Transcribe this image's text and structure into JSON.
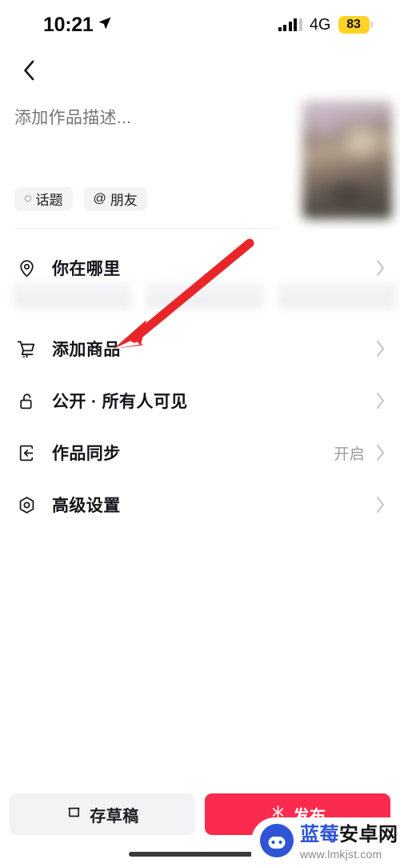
{
  "status_bar": {
    "time": "10:21",
    "location_icon": "location-arrow-icon",
    "network": "4G",
    "battery": "83",
    "battery_color": "#ffd426"
  },
  "nav": {
    "back_icon": "chevron-left-icon"
  },
  "composer": {
    "description_placeholder": "添加作品描述...",
    "description_value": "",
    "chips": [
      {
        "icon": "hash-topic-icon",
        "glyph": "◌",
        "label": "话题"
      },
      {
        "icon": "at-mention-icon",
        "glyph": "@",
        "label": "朋友"
      }
    ],
    "thumbnail_alt": "cover-thumbnail"
  },
  "rows": [
    {
      "key": "location",
      "icon": "location-pin-icon",
      "label": "你在哪里",
      "value": "",
      "chevron": "chevron-right-icon"
    },
    {
      "key": "product",
      "icon": "shopping-cart-icon",
      "label": "添加商品",
      "value": "",
      "chevron": "chevron-right-icon"
    },
    {
      "key": "visibility",
      "icon": "unlock-icon",
      "label": "公开 · 所有人可见",
      "value": "",
      "chevron": "chevron-right-icon"
    },
    {
      "key": "sync",
      "icon": "sync-export-icon",
      "label": "作品同步",
      "value": "开启",
      "chevron": "chevron-right-icon"
    },
    {
      "key": "advanced",
      "icon": "hex-gear-icon",
      "label": "高级设置",
      "value": "",
      "chevron": "chevron-right-icon"
    }
  ],
  "location_suggestions": {
    "count": 3,
    "blurred": true
  },
  "annotation": {
    "type": "arrow",
    "color": "#e8262a",
    "points_to": "添加商品"
  },
  "bottom_bar": {
    "draft": {
      "icon": "save-draft-icon",
      "label": "存草稿"
    },
    "publish": {
      "icon": "sparkle-icon",
      "label": "发布",
      "color": "#fa2b4e"
    }
  },
  "watermark": {
    "mascot": "robot-mascot-icon",
    "brand_blue": "蓝莓",
    "brand_dark": "安卓网",
    "url": "www.lmkjst.com",
    "blue": "#2f55d4"
  }
}
